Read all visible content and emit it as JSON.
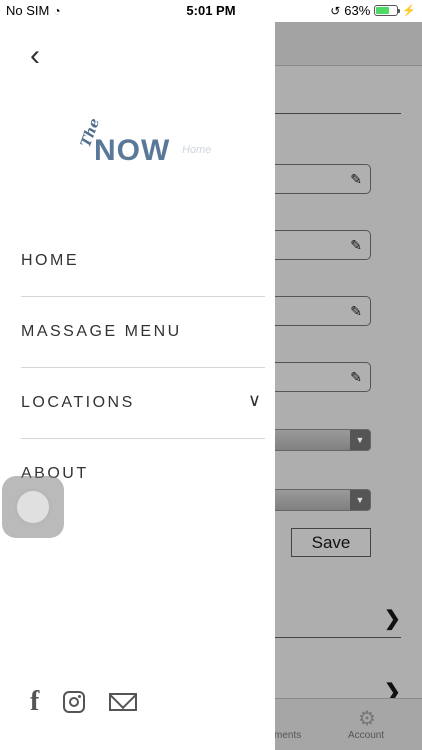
{
  "status_bar": {
    "carrier": "No SIM",
    "time": "5:01 PM",
    "battery_percent": "63%",
    "battery_level": 0.63
  },
  "drawer": {
    "logo": {
      "the": "The",
      "now": "NOW",
      "home": "Home"
    },
    "menu": [
      {
        "label": "HOME"
      },
      {
        "label": "MASSAGE MENU"
      },
      {
        "label": "LOCATIONS",
        "icon": "chevron-down-icon"
      },
      {
        "label": "ABOUT"
      }
    ],
    "social": [
      "facebook-icon",
      "instagram-icon",
      "mail-icon"
    ]
  },
  "background": {
    "save_label": "Save",
    "tabs": [
      {
        "label": "ments"
      },
      {
        "label": "Account",
        "icon": "gear-icon"
      }
    ]
  },
  "colors": {
    "logo_blue": "#5a7898",
    "menu_text": "#333333",
    "overlay_gray": "#aeaeae"
  }
}
